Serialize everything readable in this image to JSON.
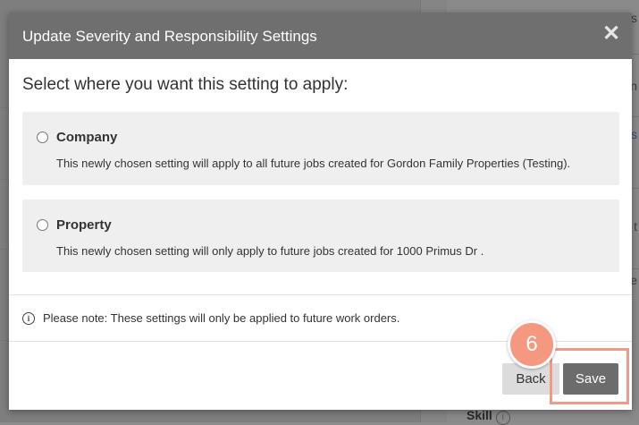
{
  "modal": {
    "title": "Update Severity and Responsibility Settings",
    "close_glyph": "✕",
    "prompt": "Select where you want this setting to apply:",
    "options": [
      {
        "label": "Company",
        "description": "This newly chosen setting will apply to all future jobs created for Gordon Family Properties (Testing).",
        "selected": false
      },
      {
        "label": "Property",
        "description": "This newly chosen setting will only apply to future jobs created for 1000 Primus Dr .",
        "selected": false
      }
    ],
    "note_icon": "i",
    "note": "Please note: These settings will only be applied to future work orders.",
    "back_label": "Back",
    "save_label": "Save"
  },
  "annotation": {
    "step_number": "6",
    "color": "#f4987f"
  },
  "background": {
    "skill_label": "Skill",
    "skill_icon": "i",
    "fragments": [
      "s",
      "n",
      "is",
      "e",
      "t"
    ]
  }
}
